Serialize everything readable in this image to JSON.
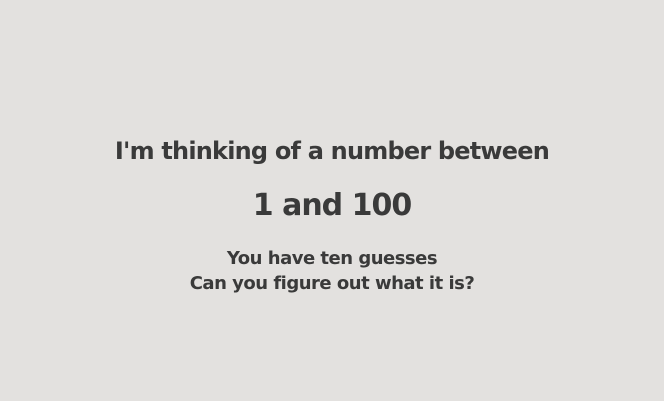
{
  "prompt": {
    "intro": "I'm thinking of a number between",
    "range": "1 and 100",
    "guesses": "You have ten guesses",
    "question": "Can you figure out what it is?"
  }
}
